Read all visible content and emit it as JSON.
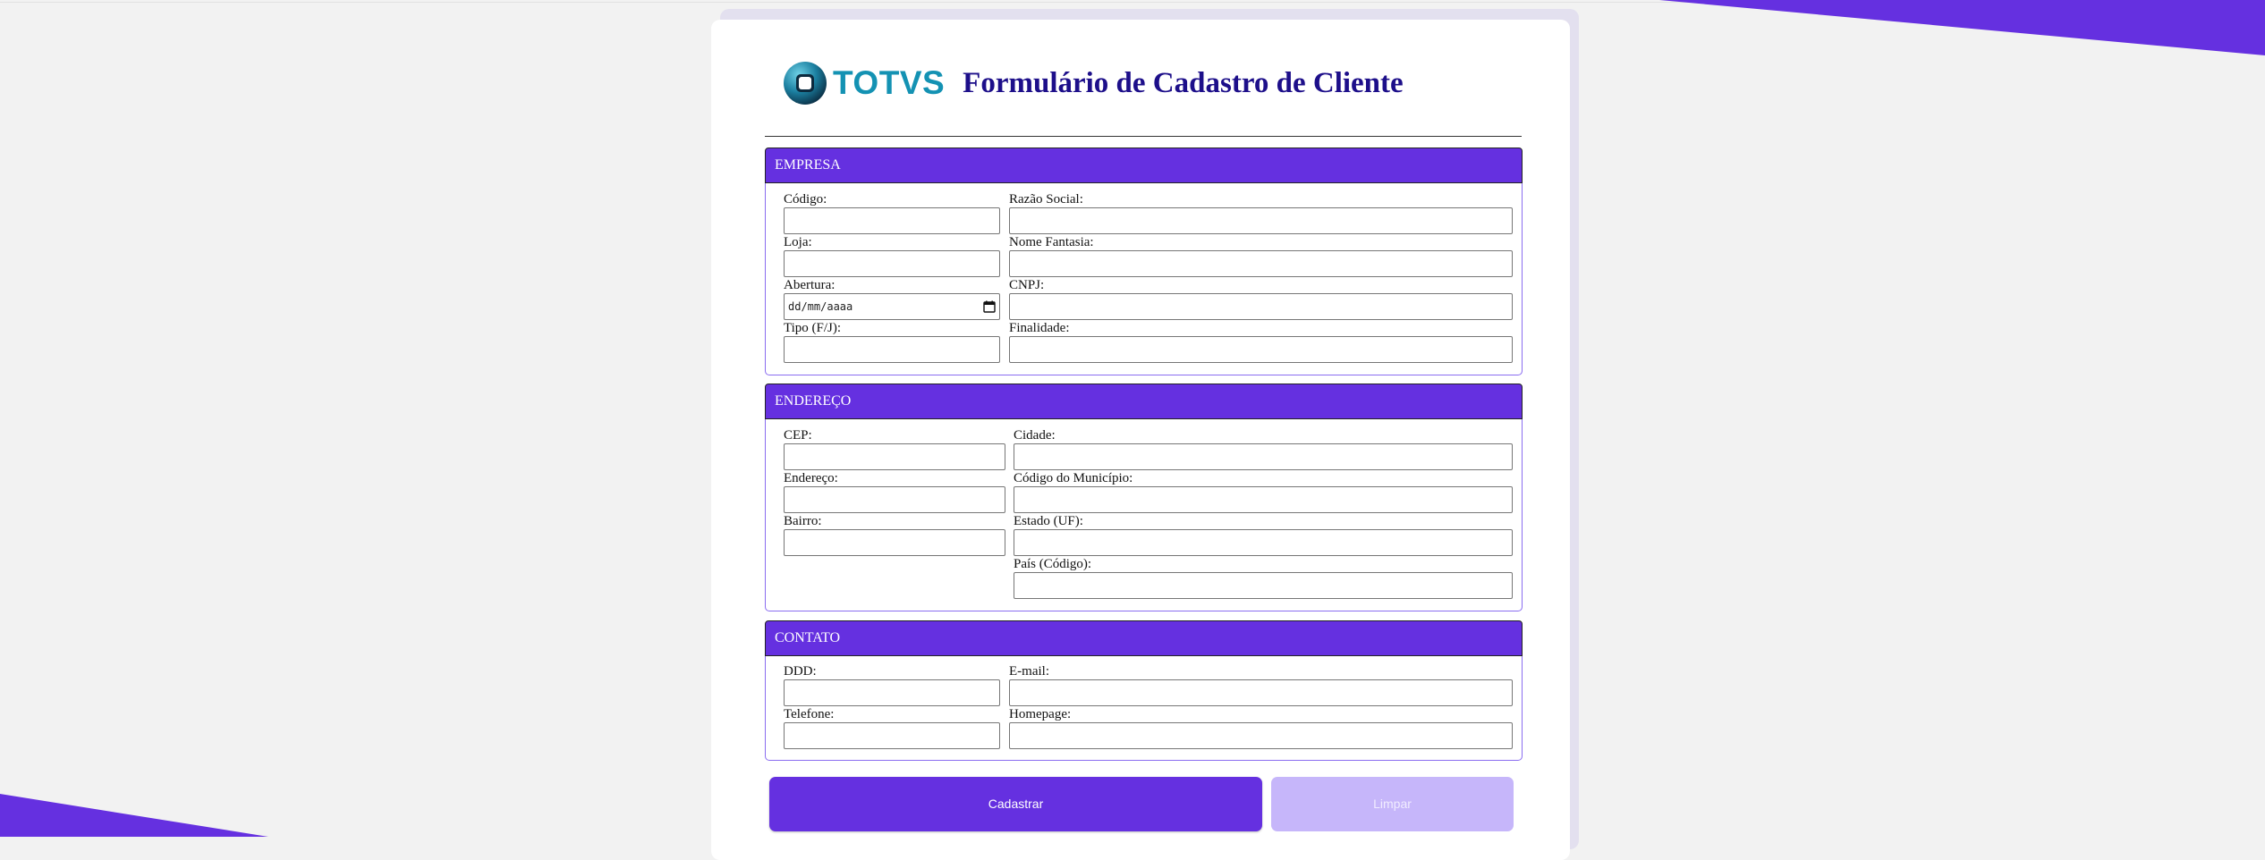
{
  "colors": {
    "accent": "#6530e0",
    "accent_light": "#c6b6fa",
    "title_color": "#1d0f8a",
    "logo_color": "#1492b3",
    "background": "#f2f2f2"
  },
  "header": {
    "logo_text": "TOTVS",
    "title": "Formulário de Cadastro de Cliente"
  },
  "sections": {
    "empresa": {
      "title": "EMPRESA",
      "codigo": {
        "label": "Código:",
        "value": ""
      },
      "razao_social": {
        "label": "Razão Social:",
        "value": ""
      },
      "loja": {
        "label": "Loja:",
        "value": ""
      },
      "nome_fantasia": {
        "label": "Nome Fantasia:",
        "value": ""
      },
      "abertura": {
        "label": "Abertura:",
        "placeholder": "dd/mm/aaaa"
      },
      "cnpj": {
        "label": "CNPJ:",
        "value": ""
      },
      "tipo": {
        "label": "Tipo (F/J):",
        "value": ""
      },
      "finalidade": {
        "label": "Finalidade:",
        "value": ""
      }
    },
    "endereco": {
      "title": "ENDEREÇO",
      "cep": {
        "label": "CEP:",
        "value": ""
      },
      "cidade": {
        "label": "Cidade:",
        "value": ""
      },
      "endereco": {
        "label": "Endereço:",
        "value": ""
      },
      "codigo_municipio": {
        "label": "Código do Município:",
        "value": ""
      },
      "bairro": {
        "label": "Bairro:",
        "value": ""
      },
      "estado": {
        "label": "Estado (UF):",
        "value": ""
      },
      "pais": {
        "label": "País (Código):",
        "value": ""
      }
    },
    "contato": {
      "title": "CONTATO",
      "ddd": {
        "label": "DDD:",
        "value": ""
      },
      "email": {
        "label": "E-mail:",
        "value": ""
      },
      "telefone": {
        "label": "Telefone:",
        "value": ""
      },
      "homepage": {
        "label": "Homepage:",
        "value": ""
      }
    }
  },
  "icons": {
    "logo": "totvs-logo-icon",
    "calendar": "calendar-icon"
  },
  "buttons": {
    "submit_label": "Cadastrar",
    "clear_label": "Limpar"
  }
}
